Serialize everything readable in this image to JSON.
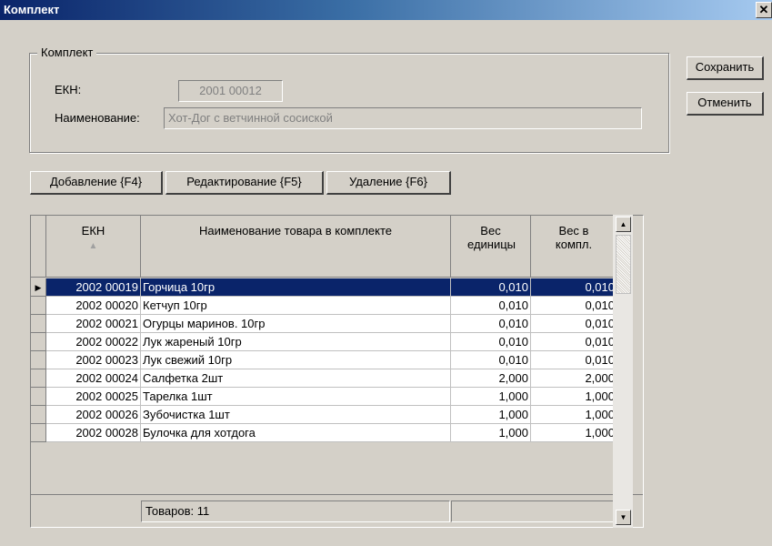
{
  "window": {
    "title": "Комплект",
    "close": "✕"
  },
  "group": {
    "title": "Комплект",
    "ekn_label": "ЕКН:",
    "ekn_value": "2001 00012",
    "name_label": "Наименование:",
    "name_value": "Хот-Дог с ветчинной сосиской"
  },
  "side_buttons": {
    "save": "Сохранить",
    "cancel": "Отменить"
  },
  "toolbar": {
    "add": "Добавление {F4}",
    "edit": "Редактирование {F5}",
    "delete": "Удаление {F6}"
  },
  "table": {
    "headers": {
      "ekn": "ЕКН",
      "name": "Наименование товара в комплекте",
      "unit_weight": "Вес единицы",
      "kit_weight": "Вес в компл."
    },
    "sort_indicator": "▲",
    "selected_indicator": "▶",
    "rows": [
      {
        "ekn": "2002 00019",
        "name": "Горчица 10гр",
        "unit_weight": "0,010",
        "kit_weight": "0,010"
      },
      {
        "ekn": "2002 00020",
        "name": "Кетчуп 10гр",
        "unit_weight": "0,010",
        "kit_weight": "0,010"
      },
      {
        "ekn": "2002 00021",
        "name": "Огурцы маринов. 10гр",
        "unit_weight": "0,010",
        "kit_weight": "0,010"
      },
      {
        "ekn": "2002 00022",
        "name": "Лук жареный 10гр",
        "unit_weight": "0,010",
        "kit_weight": "0,010"
      },
      {
        "ekn": "2002 00023",
        "name": "Лук свежий 10гр",
        "unit_weight": "0,010",
        "kit_weight": "0,010"
      },
      {
        "ekn": "2002 00024",
        "name": "Салфетка 2шт",
        "unit_weight": "2,000",
        "kit_weight": "2,000"
      },
      {
        "ekn": "2002 00025",
        "name": "Тарелка 1шт",
        "unit_weight": "1,000",
        "kit_weight": "1,000"
      },
      {
        "ekn": "2002 00026",
        "name": "Зубочистка 1шт",
        "unit_weight": "1,000",
        "kit_weight": "1,000"
      },
      {
        "ekn": "2002 00028",
        "name": "Булочка для хотдога",
        "unit_weight": "1,000",
        "kit_weight": "1,000"
      }
    ],
    "footer": "Товаров: 11"
  },
  "scrollbar": {
    "up": "▲",
    "down": "▼"
  }
}
